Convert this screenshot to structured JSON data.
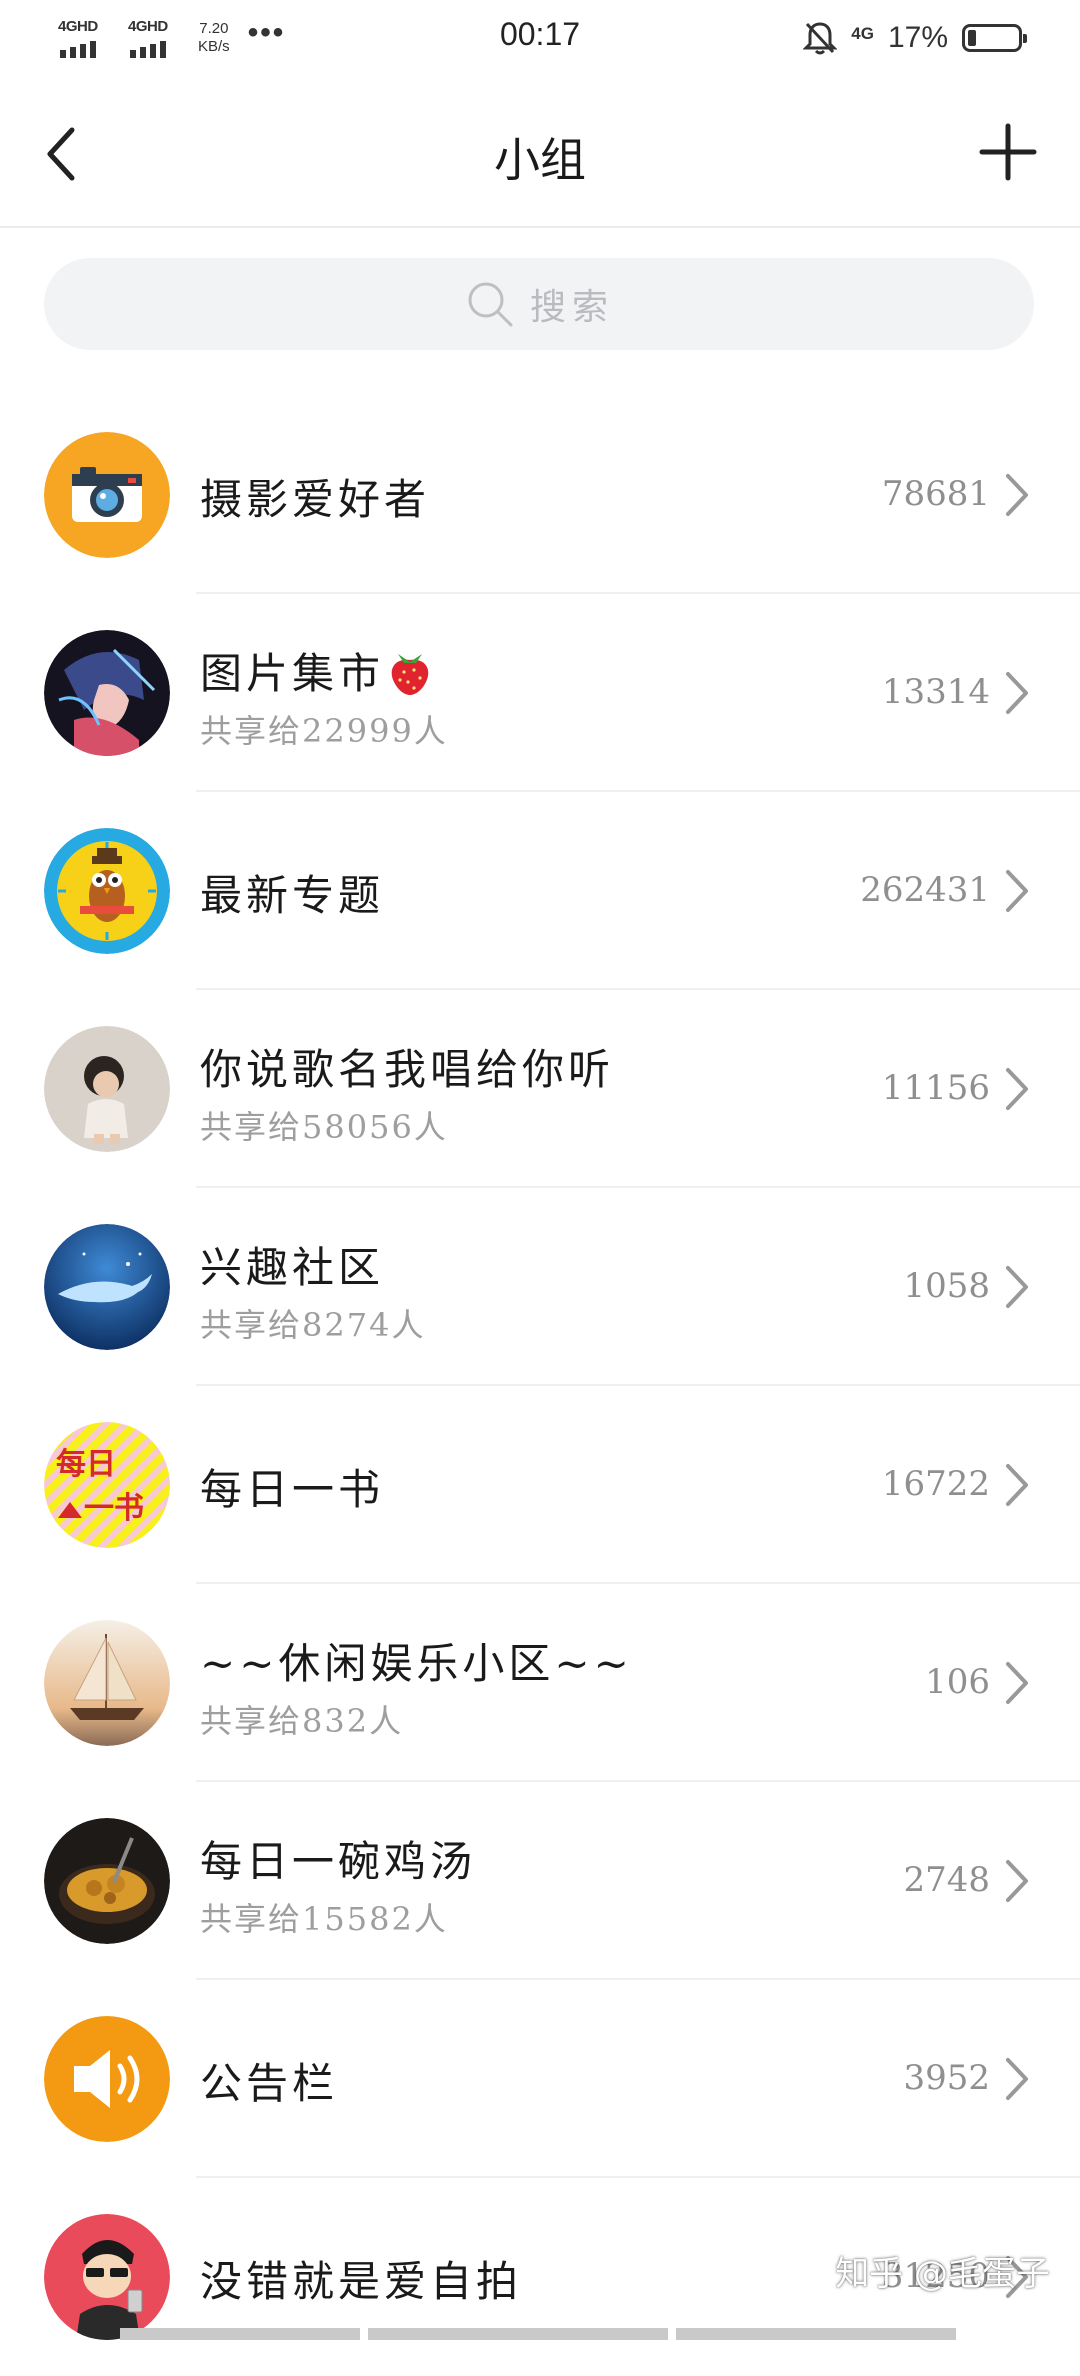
{
  "status_bar": {
    "signal1_label": "4GHD",
    "signal2_label": "4GHD",
    "speed_value": "7.20",
    "speed_unit": "KB/s",
    "more": "•••",
    "time": "00:17",
    "network": "4G",
    "battery_text": "17%",
    "battery_level": 0.17
  },
  "nav": {
    "title": "小组",
    "back_icon": "chevron-left-icon",
    "add_icon": "plus-icon"
  },
  "search": {
    "placeholder": "搜索",
    "icon": "search-icon"
  },
  "groups": [
    {
      "name": "摄影爱好者",
      "subtitle": "",
      "count": "78681",
      "avatar": "camera"
    },
    {
      "name": "图片集市",
      "subtitle": "共享给22999人",
      "count": "13314",
      "avatar": "anime-portrait",
      "emoji": "strawberry"
    },
    {
      "name": "最新专题",
      "subtitle": "",
      "count": "262431",
      "avatar": "owl-clock"
    },
    {
      "name": "你说歌名我唱给你听",
      "subtitle": "共享给58056人",
      "count": "11156",
      "avatar": "child-photo"
    },
    {
      "name": "兴趣社区",
      "subtitle": "共享给8274人",
      "count": "1058",
      "avatar": "whale-ocean"
    },
    {
      "name": "每日一书",
      "subtitle": "",
      "count": "16722",
      "avatar": "book-logo",
      "avatar_text_top": "每日",
      "avatar_text_bottom": "一书"
    },
    {
      "name": "~~休闲娱乐小区~~",
      "subtitle": "共享给832人",
      "count": "106",
      "avatar": "sailboat"
    },
    {
      "name": "每日一碗鸡汤",
      "subtitle": "共享给15582人",
      "count": "2748",
      "avatar": "soup-bowl"
    },
    {
      "name": "公告栏",
      "subtitle": "",
      "count": "3952",
      "avatar": "speaker"
    },
    {
      "name": "没错就是爱自拍",
      "subtitle": "",
      "count": "31250",
      "avatar": "selfie-cartoon"
    }
  ],
  "watermark": "知乎 @毛蛋子",
  "colors": {
    "camera_bg": "#f6a623",
    "owl_bg": "#27a9e1",
    "book_bg": "#f7f01a",
    "speaker_bg": "#f39a12",
    "selfie_bg": "#e94b5b"
  }
}
